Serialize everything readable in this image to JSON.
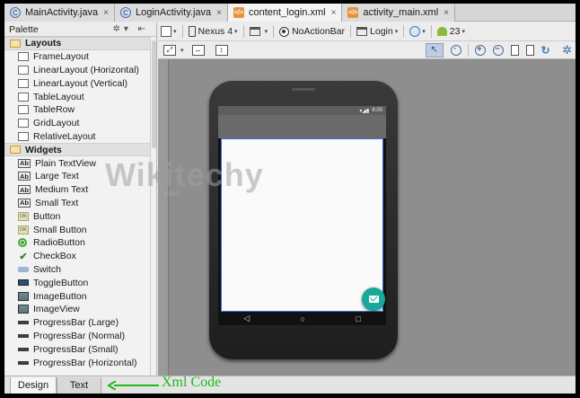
{
  "tabs": [
    {
      "label": "MainActivity.java",
      "icon": "java-class-icon"
    },
    {
      "label": "LoginActivity.java",
      "icon": "java-class-icon"
    },
    {
      "label": "content_login.xml",
      "icon": "xml-file-icon",
      "active": true
    },
    {
      "label": "activity_main.xml",
      "icon": "xml-file-icon"
    }
  ],
  "palette": {
    "title": "Palette",
    "groups": [
      {
        "label": "Layouts",
        "items": [
          "FrameLayout",
          "LinearLayout (Horizontal)",
          "LinearLayout (Vertical)",
          "TableLayout",
          "TableRow",
          "GridLayout",
          "RelativeLayout"
        ]
      },
      {
        "label": "Widgets",
        "items": [
          "Plain TextView",
          "Large Text",
          "Medium Text",
          "Small Text",
          "Button",
          "Small Button",
          "RadioButton",
          "CheckBox",
          "Switch",
          "ToggleButton",
          "ImageButton",
          "ImageView",
          "ProgressBar (Large)",
          "ProgressBar (Normal)",
          "ProgressBar (Small)",
          "ProgressBar (Horizontal)"
        ]
      }
    ],
    "text_icon_label": "Ab",
    "button_icon_label": "OK"
  },
  "toolbar": {
    "device": "Nexus 4",
    "theme": "NoActionBar",
    "activity": "Login",
    "api": "23"
  },
  "phone": {
    "status_time": "6:00",
    "nav_back": "◁",
    "nav_home": "○",
    "nav_recent": "□",
    "accent": "#19a89a"
  },
  "bottom_tabs": {
    "design": "Design",
    "text": "Text"
  },
  "annotation": {
    "label": "Xml Code",
    "color": "#1dbb1d"
  },
  "watermark": {
    "text": "Wikitechy",
    "sub": ".com"
  }
}
